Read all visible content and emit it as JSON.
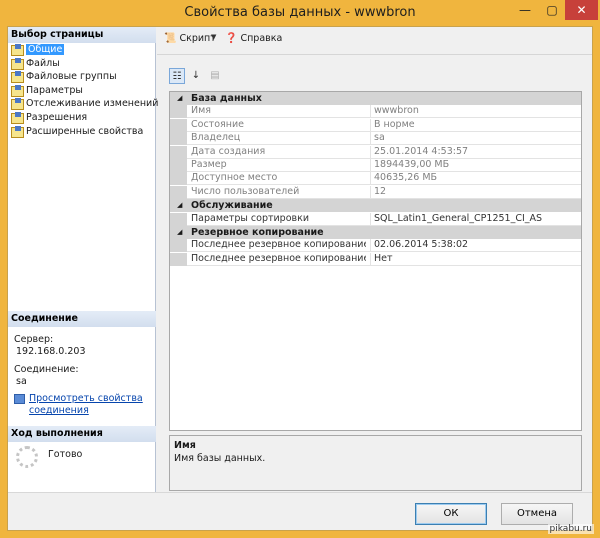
{
  "window": {
    "title": "Свойства базы данных - wwwbron",
    "minimize": "—",
    "maximize": "▢",
    "close": "✕"
  },
  "left": {
    "page_select_header": "Выбор страницы",
    "pages": [
      "Общие",
      "Файлы",
      "Файловые группы",
      "Параметры",
      "Отслеживание изменений",
      "Разрешения",
      "Расширенные свойства"
    ],
    "selected_index": 0,
    "connection_header": "Соединение",
    "server_label": "Сервер:",
    "server_value": "192.168.0.203",
    "connection_label": "Соединение:",
    "connection_value": "sa",
    "view_link": "Просмотреть свойства соединения",
    "progress_header": "Ход выполнения",
    "progress_status": "Готово"
  },
  "toolbar": {
    "script": "Скрипт",
    "help": "Справка"
  },
  "grid": {
    "categories": [
      {
        "name": "База данных",
        "rows": [
          {
            "key": "Имя",
            "value": "wwwbron"
          },
          {
            "key": "Состояние",
            "value": "В норме"
          },
          {
            "key": "Владелец",
            "value": "sa"
          },
          {
            "key": "Дата создания",
            "value": "25.01.2014 4:53:57"
          },
          {
            "key": "Размер",
            "value": "1894439,00 МБ"
          },
          {
            "key": "Доступное место",
            "value": "40635,26 МБ"
          },
          {
            "key": "Число пользователей",
            "value": "12"
          }
        ]
      },
      {
        "name": "Обслуживание",
        "rows": [
          {
            "key": "Параметры сортировки",
            "value": "SQL_Latin1_General_CP1251_CI_AS"
          }
        ]
      },
      {
        "name": "Резервное копирование",
        "rows": [
          {
            "key": "Последнее резервное копирование базы",
            "value": "02.06.2014 5:38:02"
          },
          {
            "key": "Последнее резервное копирование журн",
            "value": "Нет"
          }
        ]
      }
    ]
  },
  "description": {
    "title": "Имя",
    "text": "Имя базы данных."
  },
  "footer": {
    "ok": "ОК",
    "cancel": "Отмена"
  },
  "watermark": "pikabu.ru"
}
